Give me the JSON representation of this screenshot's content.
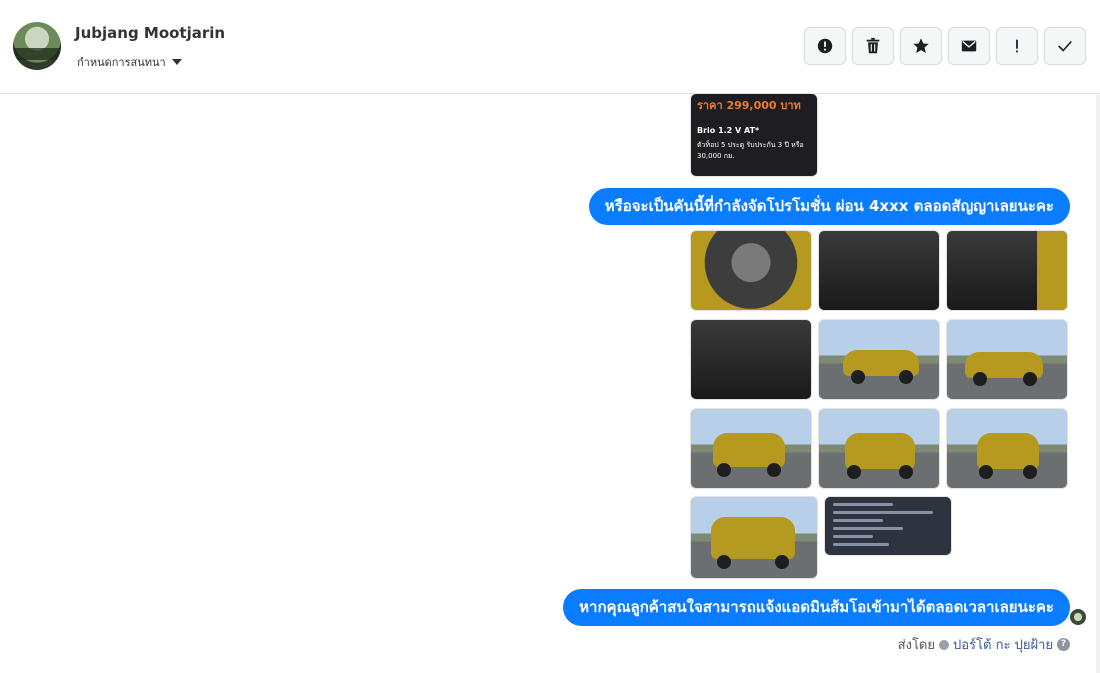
{
  "header": {
    "name": "Jubjang Mootjarin",
    "assign_label": "กำหนดการสนทนา",
    "actions": [
      "report",
      "delete",
      "star",
      "mail",
      "important",
      "done"
    ]
  },
  "messages": [
    {
      "type": "image-card",
      "price": "ราคา 299,000 บาท",
      "model": "Brio 1.2 V AT*",
      "note": "ตัวท็อป 5 ประตู รับประกัน 3 ปี หรือ 30,000 กม."
    },
    {
      "type": "text",
      "text": "หรือจะเป็นคันนี้ที่กำลังจัดโปรโมชั่น ผ่อน 4xxx ตลอดสัญญาเลยนะคะ"
    },
    {
      "type": "image-grid",
      "images": [
        "engine",
        "gear-shift",
        "rear-seats",
        "dashboard",
        "side-view",
        "front-3q",
        "rear-3q",
        "rear",
        "front",
        "front-low",
        "document"
      ]
    },
    {
      "type": "text",
      "text": "หากคุณลูกค้าสนใจสามารถแจ้งแอดมินส้มโอเข้ามาได้ตลอดเวลาเลยนะคะ"
    }
  ],
  "sent_by": {
    "prefix": "ส่งโดย",
    "author": "ปอร์โต้ กะ ปุยฝ้าย",
    "help": "?"
  }
}
